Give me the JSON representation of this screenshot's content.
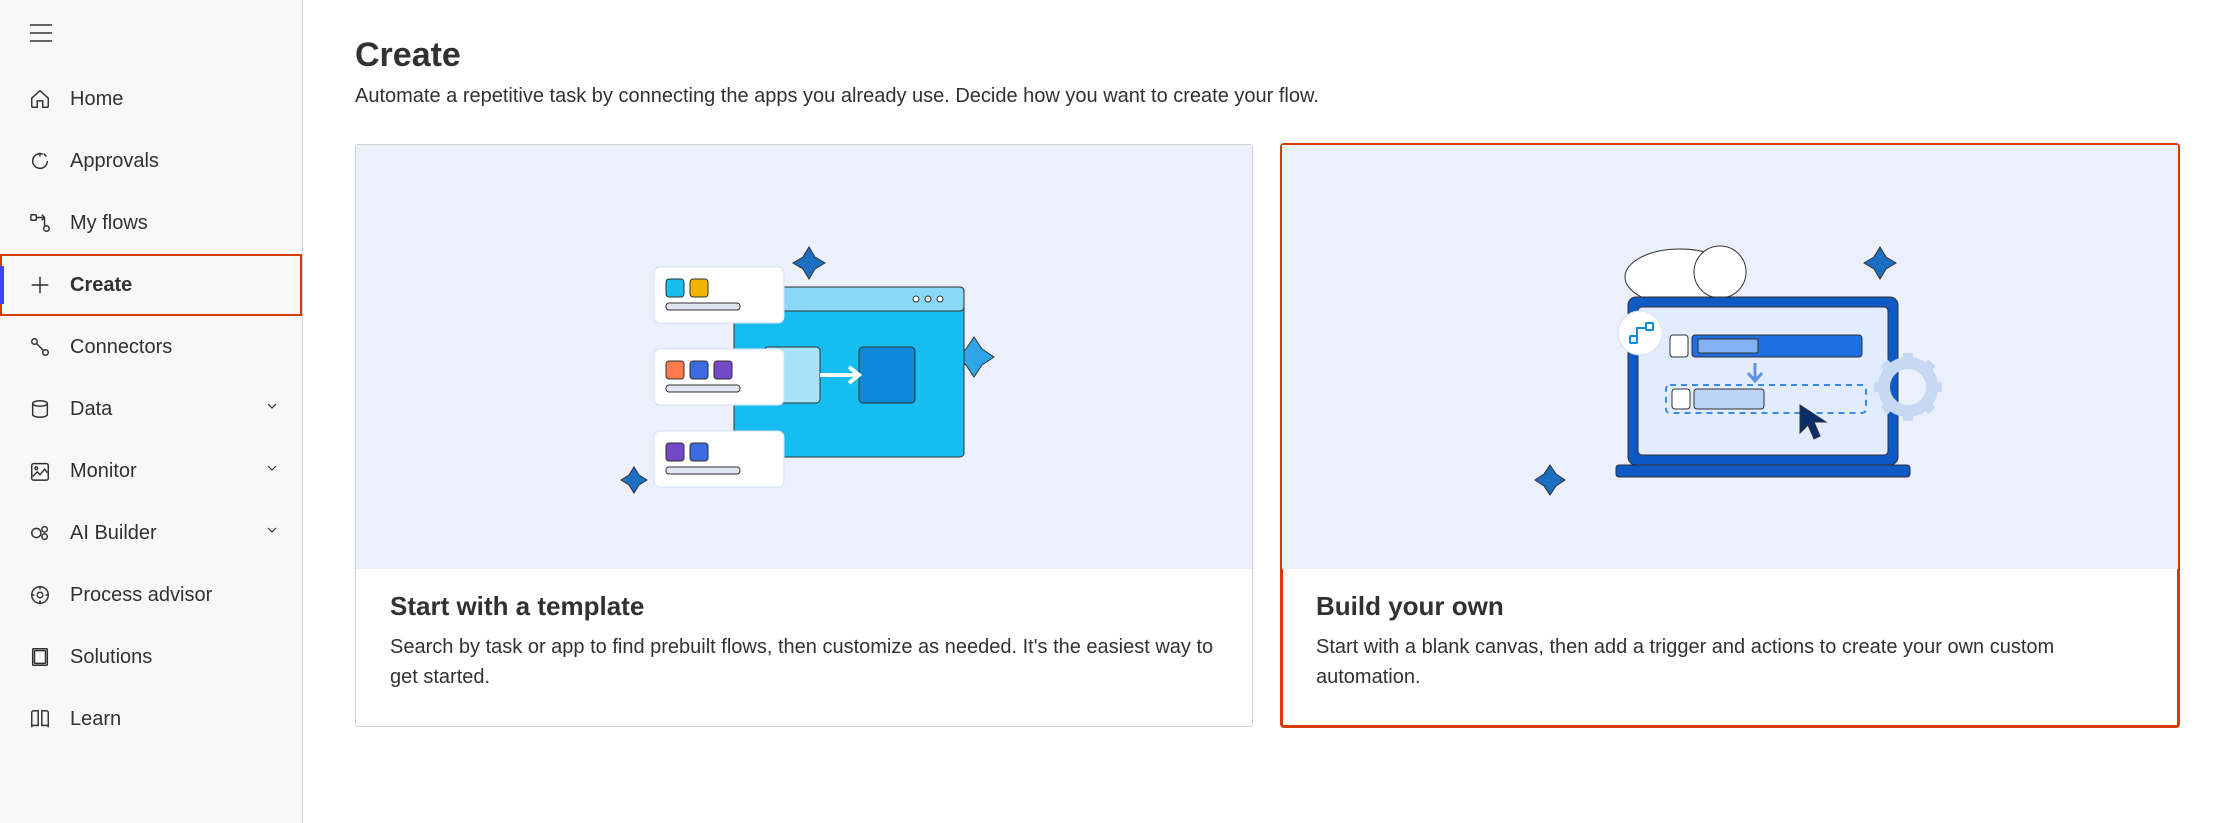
{
  "page": {
    "title": "Create",
    "subtitle": "Automate a repetitive task by connecting the apps you already use. Decide how you want to create your flow."
  },
  "sidebar": {
    "items": [
      {
        "label": "Home",
        "icon": "home-icon",
        "selected": false,
        "expandable": false
      },
      {
        "label": "Approvals",
        "icon": "approvals-icon",
        "selected": false,
        "expandable": false
      },
      {
        "label": "My flows",
        "icon": "flows-icon",
        "selected": false,
        "expandable": false
      },
      {
        "label": "Create",
        "icon": "plus-icon",
        "selected": true,
        "expandable": false
      },
      {
        "label": "Connectors",
        "icon": "connectors-icon",
        "selected": false,
        "expandable": false
      },
      {
        "label": "Data",
        "icon": "data-icon",
        "selected": false,
        "expandable": true
      },
      {
        "label": "Monitor",
        "icon": "monitor-icon",
        "selected": false,
        "expandable": true
      },
      {
        "label": "AI Builder",
        "icon": "ai-builder-icon",
        "selected": false,
        "expandable": true
      },
      {
        "label": "Process advisor",
        "icon": "process-advisor-icon",
        "selected": false,
        "expandable": false
      },
      {
        "label": "Solutions",
        "icon": "solutions-icon",
        "selected": false,
        "expandable": false
      },
      {
        "label": "Learn",
        "icon": "learn-icon",
        "selected": false,
        "expandable": false
      }
    ]
  },
  "cards": [
    {
      "title": "Start with a template",
      "desc": "Search by task or app to find prebuilt flows, then customize as needed. It's the easiest way to get started.",
      "highlighted": false
    },
    {
      "title": "Build your own",
      "desc": "Start with a blank canvas, then add a trigger and actions to create your own custom automation.",
      "highlighted": true
    }
  ]
}
